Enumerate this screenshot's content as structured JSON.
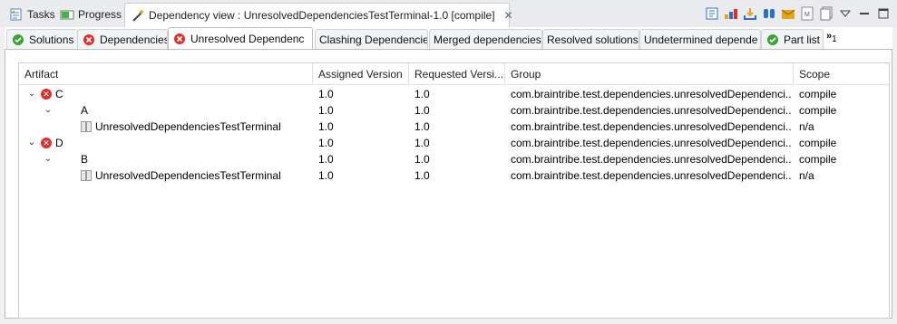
{
  "view_tabs": [
    {
      "label": "Tasks",
      "icon": "tasks-icon"
    },
    {
      "label": "Progress",
      "icon": "progress-icon"
    },
    {
      "label": "Dependency view : UnresolvedDependenciesTestTerminal-1.0 [compile]",
      "icon": "wand-icon",
      "active": true
    }
  ],
  "toolbar_icons": [
    "toggle-icon",
    "folder-color-icon",
    "import-icon",
    "filter-icon",
    "save-icon",
    "markdown-icon",
    "copy-icon",
    "view-menu-icon",
    "minimize-icon",
    "maximize-icon"
  ],
  "sub_tabs": [
    {
      "label": "Solutions",
      "icon": "ok-icon"
    },
    {
      "label": "Dependencies",
      "icon": "error-icon"
    },
    {
      "label": "Unresolved Dependenc",
      "icon": "error-icon",
      "active": true
    },
    {
      "label": "Clashing Dependencie",
      "icon": ""
    },
    {
      "label": "Merged dependencies",
      "icon": ""
    },
    {
      "label": "Resolved solutions",
      "icon": ""
    },
    {
      "label": "Undetermined depende",
      "icon": ""
    },
    {
      "label": "Part list",
      "icon": "ok-icon"
    }
  ],
  "overflow_label": "»",
  "overflow_count": "1",
  "table": {
    "columns": [
      "Artifact",
      "Assigned Version",
      "Requested Versi...",
      "Group",
      "Scope"
    ],
    "rows": [
      {
        "artifact": "C",
        "assigned": "1.0",
        "requested": "1.0",
        "group": "com.braintribe.test.dependencies.unresolvedDependenci...",
        "scope": "compile"
      },
      {
        "artifact": "A",
        "assigned": "1.0",
        "requested": "1.0",
        "group": "com.braintribe.test.dependencies.unresolvedDependenci...",
        "scope": "compile"
      },
      {
        "artifact": "UnresolvedDependenciesTestTerminal",
        "assigned": "1.0",
        "requested": "1.0",
        "group": "com.braintribe.test.dependencies.unresolvedDependenci...",
        "scope": "n/a"
      },
      {
        "artifact": "D",
        "assigned": "1.0",
        "requested": "1.0",
        "group": "com.braintribe.test.dependencies.unresolvedDependenci...",
        "scope": "compile"
      },
      {
        "artifact": "B",
        "assigned": "1.0",
        "requested": "1.0",
        "group": "com.braintribe.test.dependencies.unresolvedDependenci...",
        "scope": "compile"
      },
      {
        "artifact": "UnresolvedDependenciesTestTerminal",
        "assigned": "1.0",
        "requested": "1.0",
        "group": "com.braintribe.test.dependencies.unresolvedDependenci...",
        "scope": "n/a"
      }
    ]
  },
  "colors": {
    "error": "#d9322e",
    "ok": "#3aa33a",
    "accent": "#2a6fc9"
  }
}
